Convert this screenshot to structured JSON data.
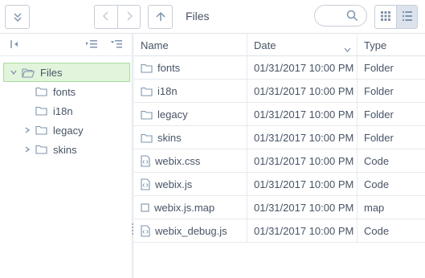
{
  "toolbar": {
    "path": "Files",
    "search_placeholder": ""
  },
  "tree": {
    "root": {
      "label": "Files",
      "expanded": true,
      "selected": true
    },
    "children": [
      {
        "label": "fonts",
        "expandable": false
      },
      {
        "label": "i18n",
        "expandable": false
      },
      {
        "label": "legacy",
        "expandable": true
      },
      {
        "label": "skins",
        "expandable": true
      }
    ]
  },
  "table": {
    "columns": [
      "Name",
      "Date",
      "Type"
    ],
    "rows": [
      {
        "name": "fonts",
        "date": "01/31/2017 10:00 PM",
        "type": "Folder",
        "icon": "folder-icon"
      },
      {
        "name": "i18n",
        "date": "01/31/2017 10:00 PM",
        "type": "Folder",
        "icon": "folder-icon"
      },
      {
        "name": "legacy",
        "date": "01/31/2017 10:00 PM",
        "type": "Folder",
        "icon": "folder-icon"
      },
      {
        "name": "skins",
        "date": "01/31/2017 10:00 PM",
        "type": "Folder",
        "icon": "folder-icon"
      },
      {
        "name": "webix.css",
        "date": "01/31/2017 10:00 PM",
        "type": "Code",
        "icon": "code-file-icon"
      },
      {
        "name": "webix.js",
        "date": "01/31/2017 10:00 PM",
        "type": "Code",
        "icon": "code-file-icon"
      },
      {
        "name": "webix.js.map",
        "date": "01/31/2017 10:00 PM",
        "type": "map",
        "icon": "file-icon"
      },
      {
        "name": "webix_debug.js",
        "date": "01/31/2017 10:00 PM",
        "type": "Code",
        "icon": "code-file-icon"
      }
    ]
  },
  "colors": {
    "selected_bg": "#e2f5dc",
    "selected_border": "#a6dba0",
    "text": "#475466",
    "icon": "#7f94ad"
  }
}
